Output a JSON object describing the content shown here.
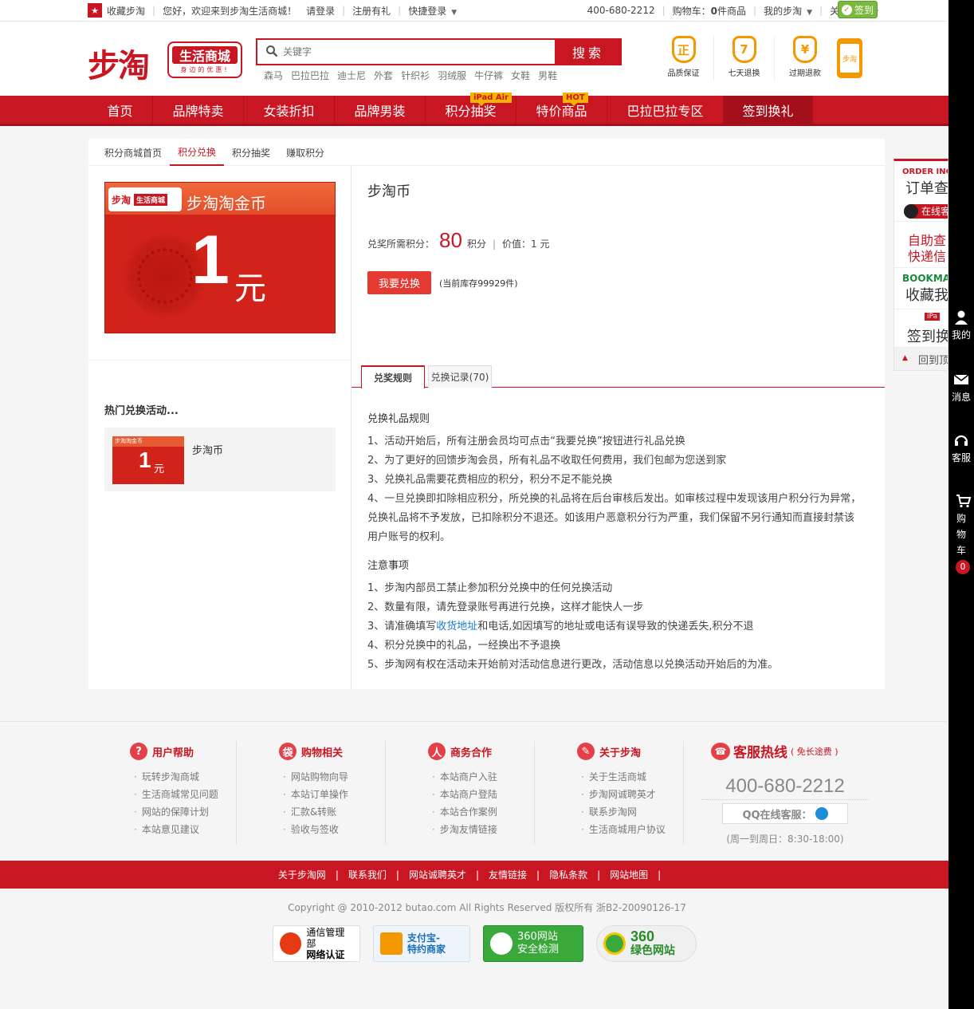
{
  "topbar": {
    "favorite": "收藏步淘",
    "welcome": "您好，欢迎来到步淘生活商城！",
    "login": "请登录",
    "register": "注册有礼",
    "quick_login": "快捷登录",
    "hotline": "400-680-2212",
    "cart_prefix": "购物车：",
    "cart_count": "0",
    "cart_suffix": "件商品",
    "my_butao": "我的步淘",
    "follow": "关注我们",
    "signin": "签到"
  },
  "header": {
    "logo_main": "步淘",
    "logo_box": "生活商城",
    "logo_slogan": "身边的优惠!",
    "search_placeholder": "关键字",
    "search_button": "搜索",
    "hotwords": [
      "森马",
      "巴拉巴拉",
      "迪士尼",
      "外套",
      "针织衫",
      "羽绒服",
      "牛仔裤",
      "女鞋",
      "男鞋"
    ],
    "guarantees": [
      {
        "icon": "正",
        "label": "品质保证"
      },
      {
        "icon": "7",
        "label": "七天退换"
      },
      {
        "icon": "¥",
        "label": "过期退款"
      }
    ],
    "app_label": "步淘"
  },
  "nav": {
    "items": [
      {
        "label": "首页"
      },
      {
        "label": "品牌特卖"
      },
      {
        "label": "女装折扣"
      },
      {
        "label": "品牌男装"
      },
      {
        "label": "积分抽奖",
        "tag": "iPad Air"
      },
      {
        "label": "特价商品",
        "tag": "HOT"
      },
      {
        "label": "巴拉巴拉专区"
      },
      {
        "label": "签到换礼"
      }
    ]
  },
  "subtabs": [
    "积分商城首页",
    "积分兑换",
    "积分抽奖",
    "赚取积分"
  ],
  "card": {
    "logo": "步淘",
    "logo_r": "生活商城",
    "name": "步淘淘金币",
    "amount": "1",
    "unit": "元"
  },
  "hot": {
    "title": "热门兑换活动...",
    "item_name": "步淘币",
    "thumb_head": "步淘淘金币"
  },
  "product": {
    "title": "步淘币",
    "points_label": "兑奖所需积分：",
    "points": "80",
    "points_unit": "积分",
    "value_label": "价值：1  元",
    "redeem": "我要兑换",
    "stock": "(当前库存99929件)"
  },
  "rtabs": [
    "兑奖规则",
    "兑换记录(70)"
  ],
  "rules": {
    "title1": "兑换礼品规则",
    "list1": [
      "1、活动开始后，所有注册会员均可点击“我要兑换”按钮进行礼品兑换",
      "2、为了更好的回馈步淘会员，所有礼品不收取任何费用，我们包邮为您送到家",
      "3、兑换礼品需要花费相应的积分，积分不足不能兑换",
      "4、一旦兑换即扣除相应积分，所兑换的礼品将在后台审核后发出。如审核过程中发现该用户积分行为异常，兑换礼品将不予发放，已扣除积分不退还。如该用户恶意积分行为严重，我们保留不另行通知而直接封禁该用户账号的权利。"
    ],
    "title2": "注意事项",
    "n1": "1、步淘内部员工禁止参加积分兑换中的任何兑换活动",
    "n2": "2、数量有限，请先登录账号再进行兑换，这样才能快人一步",
    "n3_a": "3、请准确填写",
    "n3_link": "收货地址",
    "n3_b": "和电话,如因填写的地址或电话有误导致的快递丢失,积分不退",
    "n4": "4、积分兑换中的礼品，一经换出不予退换",
    "n5": "5、步淘网有权在活动未开始前对活动信息进行更改，活动信息以兑换活动开始后的为准。"
  },
  "float_panel": {
    "order_s": "ORDER INQU",
    "order_b": "订单查",
    "online": "在线客",
    "self1": "自助查",
    "self2": "快递信",
    "bookmark_s": "BOOKMA",
    "bookmark_b": "收藏我",
    "sign_tag": "iPa",
    "sign_b": "签到换",
    "top": "回到顶"
  },
  "sidebar": {
    "mine": "我的",
    "msg": "消息",
    "service": "客服",
    "cart": "购物车",
    "cart_count": "0"
  },
  "footer": {
    "cols": [
      {
        "title": "用户帮助",
        "icon": "?",
        "links": [
          "玩转步淘商城",
          "生活商城常见问题",
          "网站的保障计划",
          "本站意见建议"
        ]
      },
      {
        "title": "购物相关",
        "icon": "袋",
        "links": [
          "网站购物向导",
          "本站订单操作",
          "汇款&转账",
          "验收与签收"
        ]
      },
      {
        "title": "商务合作",
        "icon": "人",
        "links": [
          "本站商户入驻",
          "本站商户登陆",
          "本站合作案例",
          "步淘友情链接"
        ]
      },
      {
        "title": "关于步淘",
        "icon": "✎",
        "links": [
          "关于生活商城",
          "步淘网诚聘英才",
          "联系步淘网",
          "生活商城用户协议"
        ]
      }
    ],
    "hotline_title": "客服热线",
    "hotline_note": "( 免长途费 )",
    "hotline_num": "400-680-2212",
    "qq": "QQ在线客服：",
    "hours": "(周一到周日：8:30-18:00)",
    "bar_links": [
      "关于步淘网",
      "联系我们",
      "网站诚聘英才",
      "友情链接",
      "隐私条款",
      "网站地图"
    ],
    "copyright": "Copyright @ 2010-2012 butao.com All Rights Reserved 版权所有 浙B2-20090126-17",
    "badges": [
      {
        "line1": "通信管理部",
        "line2": "网络认证",
        "color": "#e53a12"
      },
      {
        "line1": "支付宝-",
        "line2": "特约商家",
        "color": "#1a6fb8"
      },
      {
        "line1": "360网站",
        "line2": "安全检测",
        "color": "#3aa83a"
      },
      {
        "line1": "360",
        "line2": "绿色网站",
        "color": "#3aa83a"
      }
    ]
  }
}
